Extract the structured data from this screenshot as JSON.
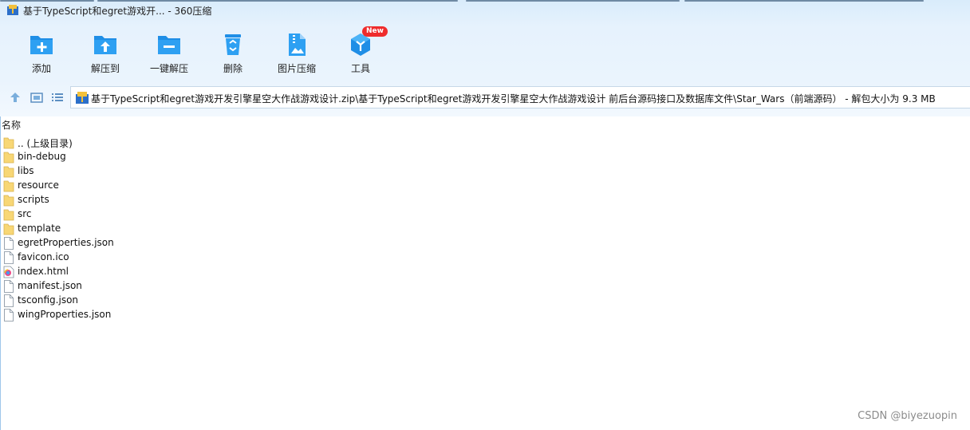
{
  "window": {
    "title": "基于TypeScript和egret游戏开... - 360压缩"
  },
  "toolbar": {
    "items": [
      {
        "label": "添加",
        "icon": "add-folder-icon"
      },
      {
        "label": "解压到",
        "icon": "extract-to-icon"
      },
      {
        "label": "一键解压",
        "icon": "one-click-extract-icon"
      },
      {
        "label": "删除",
        "icon": "recycle-bin-icon"
      },
      {
        "label": "图片压缩",
        "icon": "image-compress-icon"
      },
      {
        "label": "工具",
        "icon": "tools-cube-icon",
        "badge": "New"
      }
    ]
  },
  "navigation": {
    "buttons": [
      "up-arrow-icon",
      "thumbnail-view-icon",
      "list-view-icon"
    ],
    "address": "基于TypeScript和egret游戏开发引擎星空大作战游戏设计.zip\\基于TypeScript和egret游戏开发引擎星空大作战游戏设计 前后台源码接口及数据库文件\\Star_Wars（前端源码）  - 解包大小为 9.3 MB"
  },
  "file_list": {
    "column_header": "名称",
    "rows": [
      {
        "name": ".. (上级目录)",
        "type": "folder"
      },
      {
        "name": "bin-debug",
        "type": "folder"
      },
      {
        "name": "libs",
        "type": "folder"
      },
      {
        "name": "resource",
        "type": "folder"
      },
      {
        "name": "scripts",
        "type": "folder"
      },
      {
        "name": "src",
        "type": "folder"
      },
      {
        "name": "template",
        "type": "folder"
      },
      {
        "name": "egretProperties.json",
        "type": "file"
      },
      {
        "name": "favicon.ico",
        "type": "file"
      },
      {
        "name": "index.html",
        "type": "html"
      },
      {
        "name": "manifest.json",
        "type": "file"
      },
      {
        "name": "tsconfig.json",
        "type": "file"
      },
      {
        "name": "wingProperties.json",
        "type": "file"
      }
    ]
  },
  "watermark": "CSDN @biyezuopin",
  "colors": {
    "accent": "#1e90e6",
    "folder": "#f8d775",
    "badge": "#ef2c2c"
  }
}
